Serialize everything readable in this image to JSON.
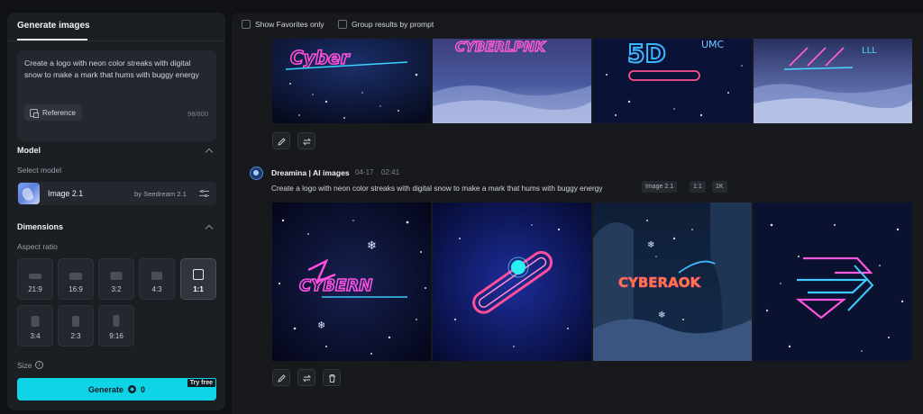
{
  "left_panel": {
    "tab": "Generate images",
    "prompt": "Create a logo with neon color streaks with digital snow to make a mark that hums with buggy energy",
    "reference_label": "Reference",
    "char_count": "98/800",
    "model_section": "Model",
    "select_model_label": "Select model",
    "model_name": "Image 2.1",
    "model_by": "by Seedream 2.1",
    "dimensions_section": "Dimensions",
    "aspect_ratio_label": "Aspect ratio",
    "ratios": [
      {
        "label": "21:9"
      },
      {
        "label": "16:9"
      },
      {
        "label": "3:2"
      },
      {
        "label": "4:3"
      },
      {
        "label": "1:1"
      },
      {
        "label": "3:4"
      },
      {
        "label": "2:3"
      },
      {
        "label": "9:16"
      }
    ],
    "selected_ratio": "1:1",
    "size_label": "Size",
    "generate_label": "Generate",
    "generate_cost": "0",
    "try_free": "Try free"
  },
  "toolbar": {
    "show_favorites": "Show Favorites only",
    "group_results": "Group results by prompt"
  },
  "generation": {
    "name": "Dreamina | AI images",
    "date": "04-17",
    "time": "02:41",
    "prompt": "Create a logo with neon color streaks with digital snow to make a mark that hums with buggy energy",
    "tags": [
      "Image 2.1",
      "1:1",
      "1K"
    ]
  },
  "top_images": [
    {
      "text": "Cyber"
    },
    {
      "text": "CYBERLPNK"
    },
    {
      "text": "5D"
    },
    {
      "text": "LLL"
    }
  ],
  "bottom_images": [
    {
      "text": "CYBERN"
    },
    {
      "text": ""
    },
    {
      "text": "CYBERAOK"
    },
    {
      "text": ""
    }
  ],
  "colors": {
    "accent": "#0fd4e6",
    "panel": "#1b1e23",
    "background": "#0f1114"
  }
}
